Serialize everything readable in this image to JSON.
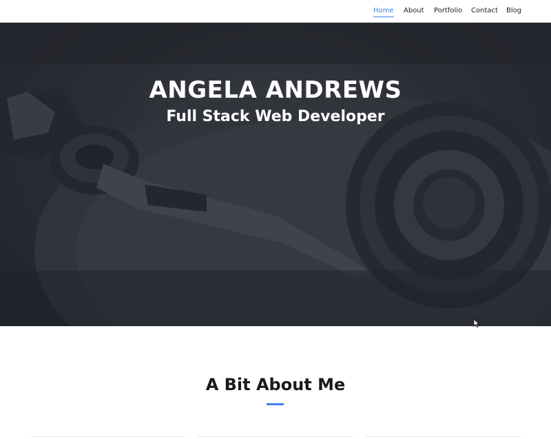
{
  "nav": {
    "items": [
      {
        "label": "Home",
        "active": true
      },
      {
        "label": "About",
        "active": false
      },
      {
        "label": "Portfolio",
        "active": false
      },
      {
        "label": "Contact",
        "active": false
      },
      {
        "label": "Blog",
        "active": false
      }
    ]
  },
  "hero": {
    "title": "ANGELA ANDREWS",
    "subtitle": "Full Stack Web Developer"
  },
  "about": {
    "heading": "A Bit About Me"
  },
  "colors": {
    "accent": "#3d84e6",
    "text_dark": "#1a1a1a",
    "hero_dark": "#2b2d33"
  }
}
